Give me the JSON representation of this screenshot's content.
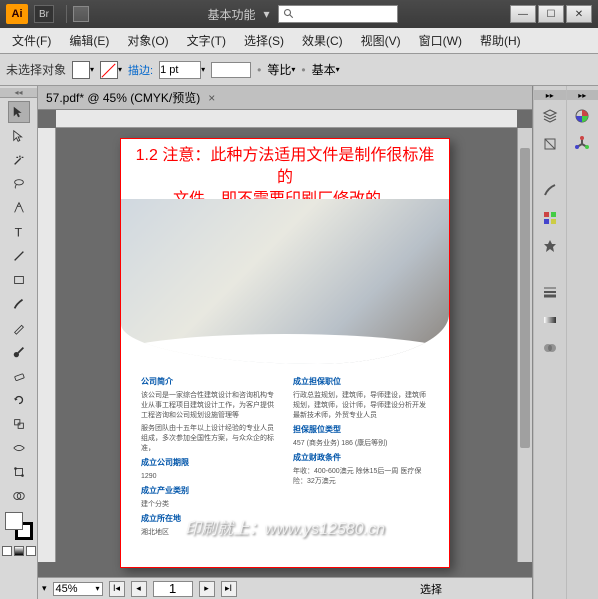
{
  "titlebar": {
    "workspace": "基本功能",
    "search_placeholder": ""
  },
  "menu": [
    "文件(F)",
    "编辑(E)",
    "对象(O)",
    "文字(T)",
    "选择(S)",
    "效果(C)",
    "视图(V)",
    "窗口(W)",
    "帮助(H)"
  ],
  "control": {
    "no_selection": "未选择对象",
    "stroke_label": "描边:",
    "stroke_value": "1 pt",
    "uniform": "等比",
    "style": "基本"
  },
  "doc_tab": {
    "title": "57.pdf* @ 45% (CMYK/预览)"
  },
  "overlay": {
    "line1": "1.2 注意：此种方法适用文件是制作很标准的",
    "line2": "文件，即不需要印刷厂修改的。"
  },
  "doc": {
    "col1": {
      "h1": "公司简介",
      "p1": "该公司是一家综合性建筑设计和咨询机构专业从事工程项目建筑设计工作，为客户提供工程咨询和公司规划设施管理等",
      "p2": "服务团队由十五年以上设计经验的专业人员组成，多次参加全国性方案，与众众企的标准，",
      "h2": "成立公司期限",
      "p3": "1290",
      "h3": "成立产业类别",
      "p4": "建个分类",
      "h4": "成立所在地",
      "p5": "湘北地区"
    },
    "col2": {
      "h1": "成立担保职位",
      "p1": "行政总监规划，建筑师，导师建设，建筑师规划，建筑师，设计师，导师建设分析开发最新技术师，外贸专业人员",
      "h2": "担保服位类型",
      "p2": "457 (商务业务) 186 (康后等别)",
      "h3": "成立财政条件",
      "p3": "年收：400-600澳元 除休15后一周 医疗保险：32万澳元"
    }
  },
  "watermark": "印刷就上：www.ys12580.cn",
  "status": {
    "zoom": "45%",
    "page": "1",
    "mode": "选择"
  }
}
